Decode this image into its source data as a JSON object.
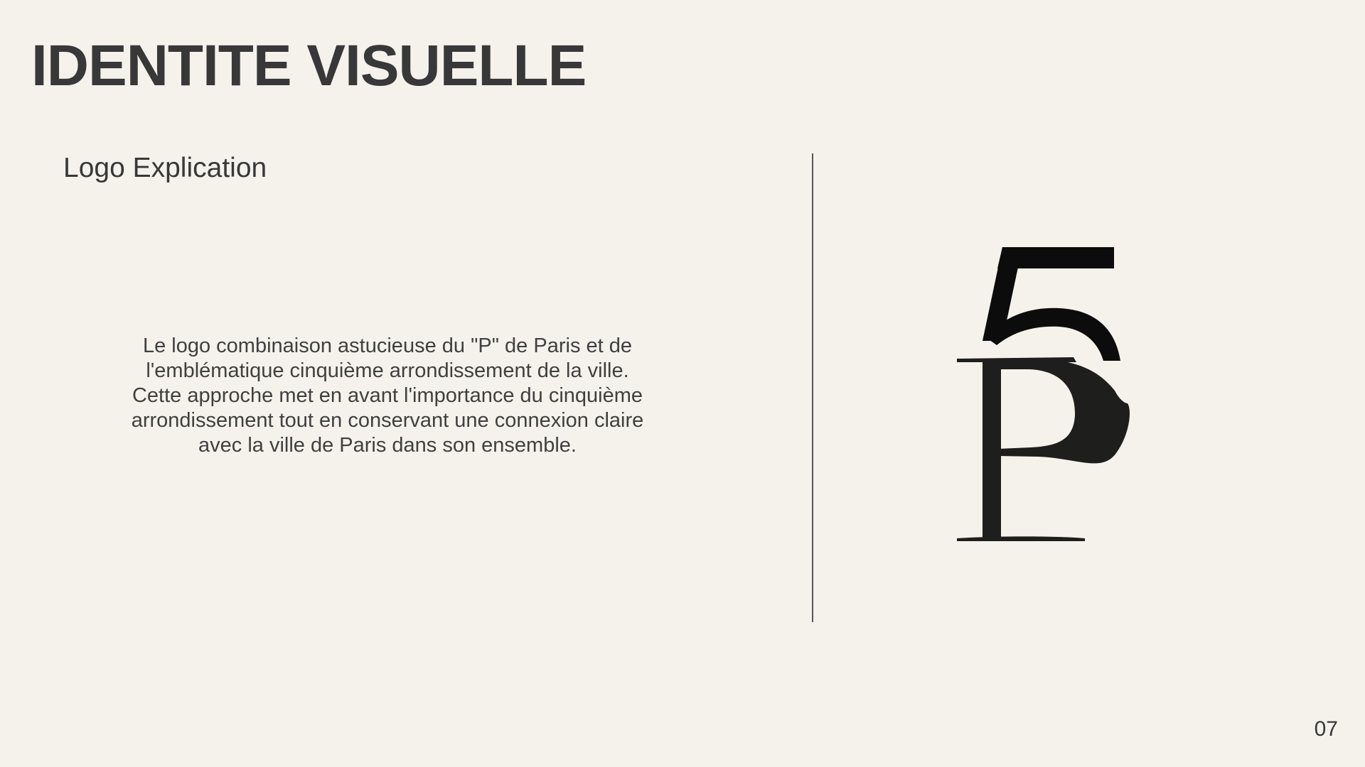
{
  "slide": {
    "title": "IDENTITE VISUELLE",
    "subtitle": "Logo Explication",
    "description": "Le logo combinaison astucieuse du \"P\" de Paris et de l'emblématique cinquième arrondissement de la ville. Cette approche met en avant l'importance du cinquième arrondissement tout en conservant une connexion claire avec la ville de Paris dans son ensemble.",
    "page_number": "07"
  },
  "logo": {
    "icon": "p5-monogram-logo",
    "color": "#1e1e1c"
  },
  "colors": {
    "background": "#f5f2ec",
    "text": "#383838"
  }
}
